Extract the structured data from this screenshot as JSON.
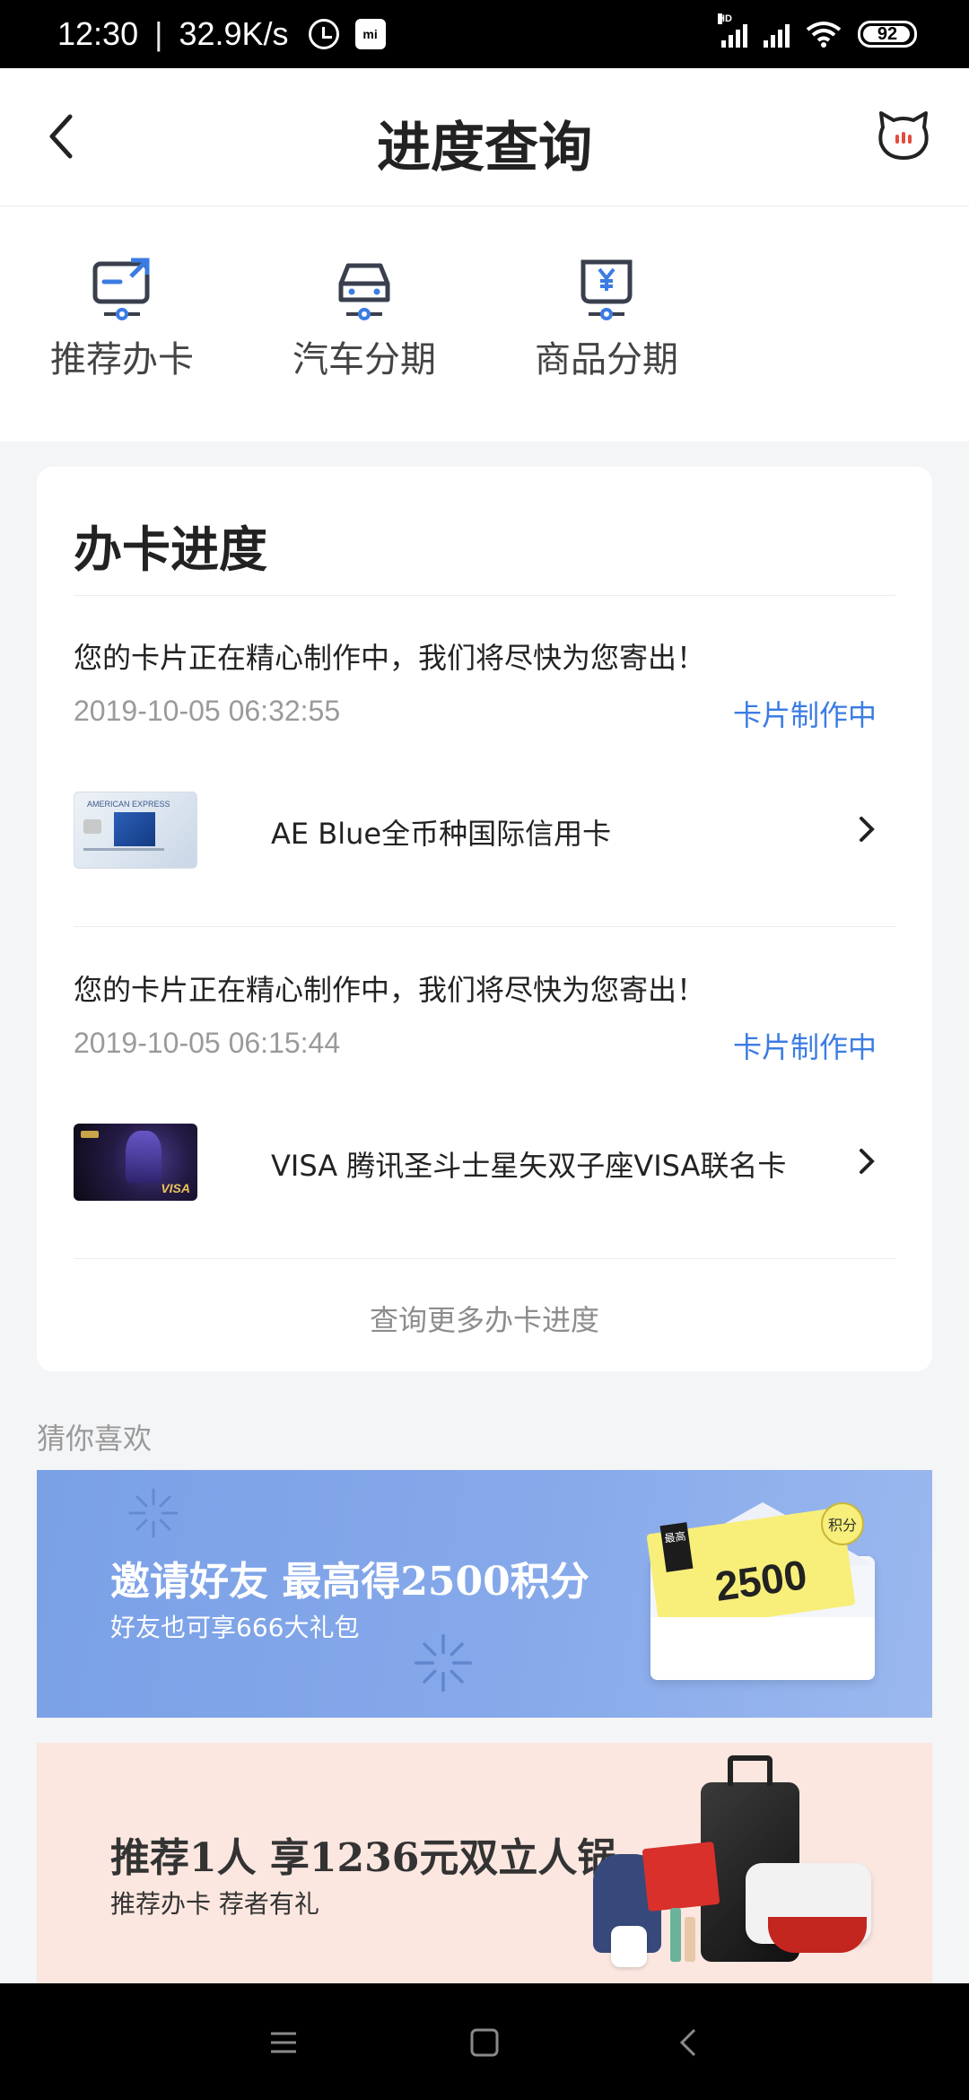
{
  "status_bar": {
    "time": "12:30",
    "speed": "32.9K/s",
    "network_label": "HD",
    "battery": "92",
    "mi_label": "mi"
  },
  "header": {
    "title": "进度查询"
  },
  "quick_actions": [
    {
      "label": "推荐办卡",
      "icon": "card-share-icon"
    },
    {
      "label": "汽车分期",
      "icon": "car-icon"
    },
    {
      "label": "商品分期",
      "icon": "yuan-bag-icon"
    }
  ],
  "progress": {
    "title": "办卡进度",
    "items": [
      {
        "message": "您的卡片正在精心制作中，我们将尽快为您寄出！",
        "time": "2019-10-05 06:32:55",
        "status": "卡片制作中",
        "card_name": "AE Blue全币种国际信用卡",
        "card_brand": "AMERICAN EXPRESS"
      },
      {
        "message": "您的卡片正在精心制作中，我们将尽快为您寄出！",
        "time": "2019-10-05 06:15:44",
        "status": "卡片制作中",
        "card_name": "VISA 腾讯圣斗士星矢双子座VISA联名卡",
        "card_brand": "VISA"
      }
    ],
    "more_link": "查询更多办卡进度"
  },
  "recommend": {
    "label": "猜你喜欢",
    "banners": [
      {
        "title": "邀请好友 最高得2500积分",
        "subtitle": "好友也可享666大礼包",
        "badge": "2500",
        "tag": "积分",
        "ribbon": "最高"
      },
      {
        "title": "推荐1人 享1236元双立人锅",
        "subtitle": "推荐办卡 荐者有礼"
      }
    ]
  },
  "colors": {
    "accent": "#3b7ce3",
    "banner_blue": "#86a9ea",
    "banner_pink": "#fbe7e0"
  }
}
